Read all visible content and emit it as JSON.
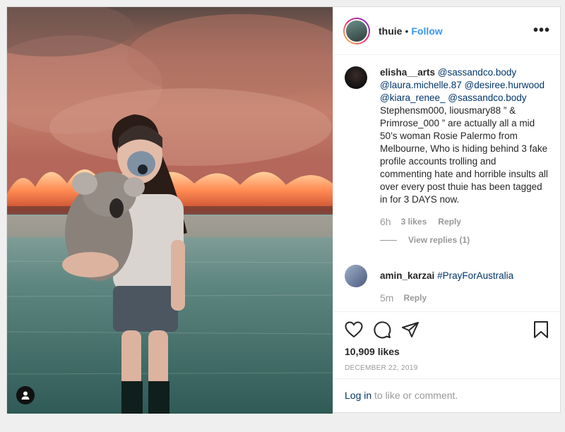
{
  "post": {
    "username": "thuie",
    "separator": "•",
    "follow_label": "Follow",
    "more_label": "•••",
    "likes_count": "10,909 likes",
    "date": "DECEMBER 22, 2019"
  },
  "comments": [
    {
      "username": "elisha__arts",
      "mentions": [
        "@sassandco.body",
        "@laura.michelle.87",
        "@desiree.hurwood",
        "@kiara_renee_",
        "@sassandco.body"
      ],
      "text": "Stephensm000, liousmary88 ” & Primrose_000 ” are actually all a mid 50’s woman Rosie Palermo from Melbourne, Who is hiding behind 3 fake profile accounts trolling and commenting hate and horrible insults all over every post thuie has been tagged in for 3 DAYS now.",
      "time": "6h",
      "likes": "3 likes",
      "reply": "Reply",
      "view_replies": "View replies (1)"
    },
    {
      "username": "amin_karzai",
      "hashtag": "#PrayForAustralia",
      "time": "5m",
      "reply": "Reply"
    }
  ],
  "actions": {
    "icons": [
      "heart-icon",
      "comment-icon",
      "share-icon",
      "bookmark-icon"
    ]
  },
  "login": {
    "link": "Log in",
    "text": " to like or comment."
  },
  "colors": {
    "link_blue": "#3897f0",
    "mention_blue": "#003569",
    "muted_gray": "#999999",
    "text": "#262626"
  }
}
